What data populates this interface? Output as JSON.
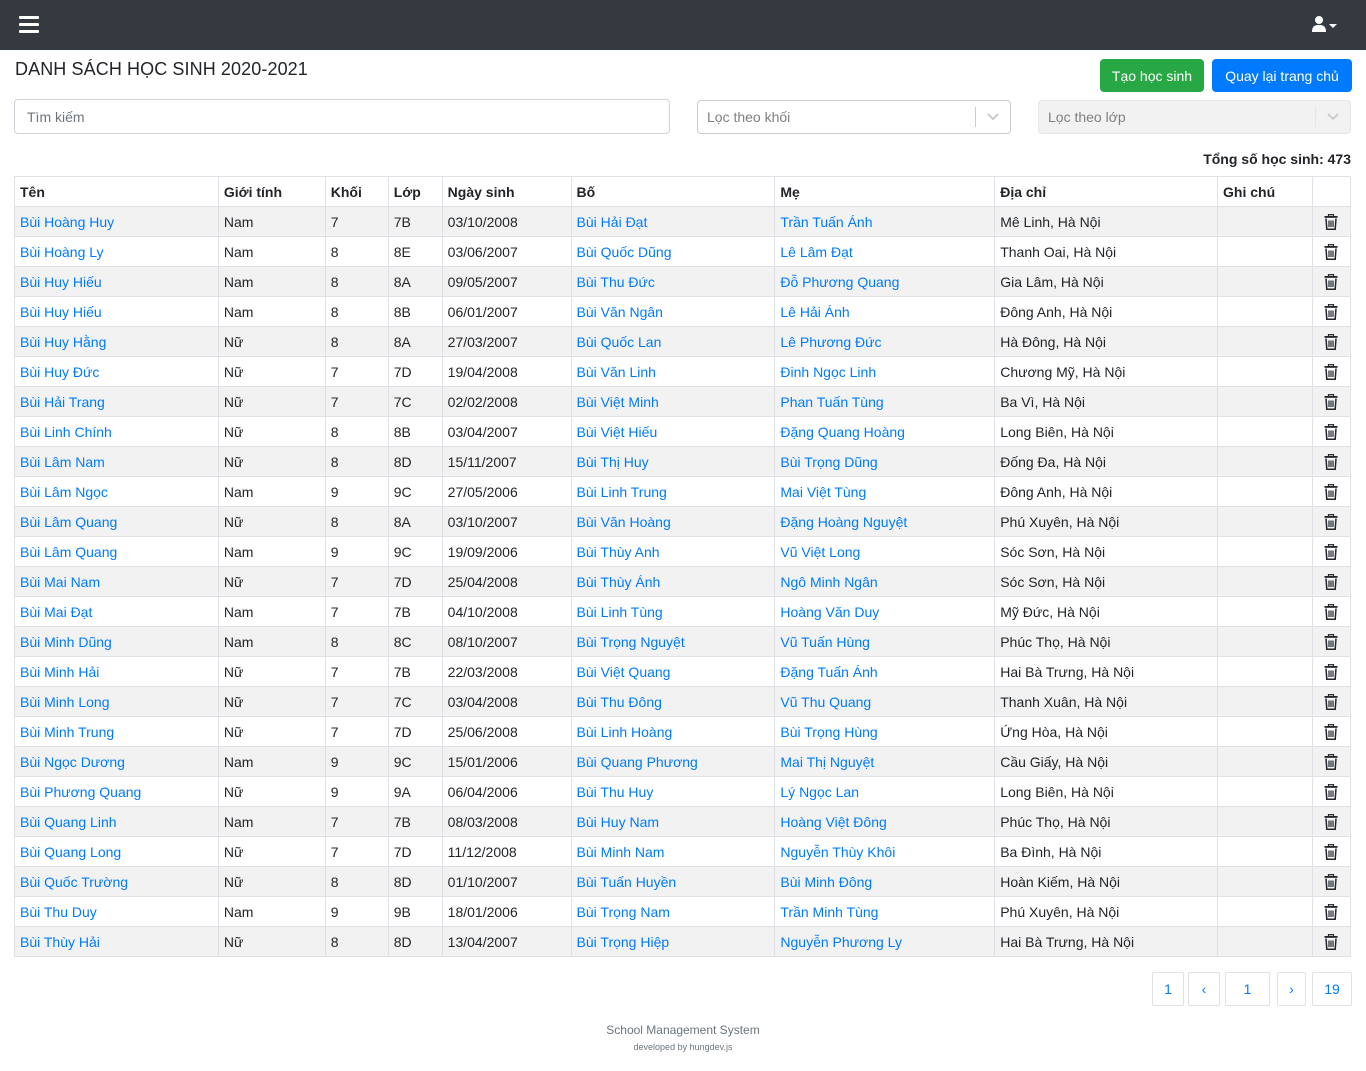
{
  "navbar": {
    "menu_icon": "hamburger-icon",
    "user_icon": "user-icon",
    "caret_icon": "caret-down-icon"
  },
  "page": {
    "title": "DANH SÁCH HỌC SINH 2020-2021"
  },
  "actions": {
    "create_label": "Tạo học sinh",
    "home_label": "Quay lại trang chủ"
  },
  "filters": {
    "search_placeholder": "Tìm kiếm",
    "grade_placeholder": "Lọc theo khối",
    "class_placeholder": "Lọc theo lớp"
  },
  "summary": {
    "total_text": "Tổng số học sinh: 473"
  },
  "table": {
    "headers": [
      "Tên",
      "Giới tính",
      "Khối",
      "Lớp",
      "Ngày sinh",
      "Bố",
      "Mẹ",
      "Địa chỉ",
      "Ghi chú",
      ""
    ],
    "rows": [
      {
        "name": "Bùi Hoàng Huy",
        "gender": "Nam",
        "grade": "7",
        "class": "7B",
        "dob": "03/10/2008",
        "father": "Bùi Hải Đạt",
        "mother": "Trần Tuấn Ánh",
        "address": "Mê Linh, Hà Nội",
        "note": ""
      },
      {
        "name": "Bùi Hoàng Ly",
        "gender": "Nam",
        "grade": "8",
        "class": "8E",
        "dob": "03/06/2007",
        "father": "Bùi Quốc Dũng",
        "mother": "Lê Lâm Đạt",
        "address": "Thanh Oai, Hà Nội",
        "note": ""
      },
      {
        "name": "Bùi Huy Hiếu",
        "gender": "Nam",
        "grade": "8",
        "class": "8A",
        "dob": "09/05/2007",
        "father": "Bùi Thu Đức",
        "mother": "Đỗ Phương Quang",
        "address": "Gia Lâm, Hà Nội",
        "note": ""
      },
      {
        "name": "Bùi Huy Hiếu",
        "gender": "Nam",
        "grade": "8",
        "class": "8B",
        "dob": "06/01/2007",
        "father": "Bùi Văn Ngân",
        "mother": "Lê Hải Ánh",
        "address": "Đông Anh, Hà Nội",
        "note": ""
      },
      {
        "name": "Bùi Huy Hằng",
        "gender": "Nữ",
        "grade": "8",
        "class": "8A",
        "dob": "27/03/2007",
        "father": "Bùi Quốc Lan",
        "mother": "Lê Phương Đức",
        "address": "Hà Đông, Hà Nội",
        "note": ""
      },
      {
        "name": "Bùi Huy Đức",
        "gender": "Nữ",
        "grade": "7",
        "class": "7D",
        "dob": "19/04/2008",
        "father": "Bùi Văn Linh",
        "mother": "Đinh Ngọc Linh",
        "address": "Chương Mỹ, Hà Nội",
        "note": ""
      },
      {
        "name": "Bùi Hải Trang",
        "gender": "Nữ",
        "grade": "7",
        "class": "7C",
        "dob": "02/02/2008",
        "father": "Bùi Việt Minh",
        "mother": "Phan Tuấn Tùng",
        "address": "Ba Vì, Hà Nội",
        "note": ""
      },
      {
        "name": "Bùi Linh Chính",
        "gender": "Nữ",
        "grade": "8",
        "class": "8B",
        "dob": "03/04/2007",
        "father": "Bùi Việt Hiếu",
        "mother": "Đặng Quang Hoàng",
        "address": "Long Biên, Hà Nội",
        "note": ""
      },
      {
        "name": "Bùi Lâm Nam",
        "gender": "Nữ",
        "grade": "8",
        "class": "8D",
        "dob": "15/11/2007",
        "father": "Bùi Thị Huy",
        "mother": "Bùi Trọng Dũng",
        "address": "Đống Đa, Hà Nội",
        "note": ""
      },
      {
        "name": "Bùi Lâm Ngọc",
        "gender": "Nam",
        "grade": "9",
        "class": "9C",
        "dob": "27/05/2006",
        "father": "Bùi Linh Trung",
        "mother": "Mai Việt Tùng",
        "address": "Đông Anh, Hà Nội",
        "note": ""
      },
      {
        "name": "Bùi Lâm Quang",
        "gender": "Nữ",
        "grade": "8",
        "class": "8A",
        "dob": "03/10/2007",
        "father": "Bùi Văn Hoàng",
        "mother": "Đặng Hoàng Nguyệt",
        "address": "Phú Xuyên, Hà Nội",
        "note": ""
      },
      {
        "name": "Bùi Lâm Quang",
        "gender": "Nam",
        "grade": "9",
        "class": "9C",
        "dob": "19/09/2006",
        "father": "Bùi Thùy Anh",
        "mother": "Vũ Việt Long",
        "address": "Sóc Sơn, Hà Nội",
        "note": ""
      },
      {
        "name": "Bùi Mai Nam",
        "gender": "Nữ",
        "grade": "7",
        "class": "7D",
        "dob": "25/04/2008",
        "father": "Bùi Thùy Ánh",
        "mother": "Ngô Minh Ngân",
        "address": "Sóc Sơn, Hà Nội",
        "note": ""
      },
      {
        "name": "Bùi Mai Đạt",
        "gender": "Nam",
        "grade": "7",
        "class": "7B",
        "dob": "04/10/2008",
        "father": "Bùi Linh Tùng",
        "mother": "Hoàng Văn Duy",
        "address": "Mỹ Đức, Hà Nội",
        "note": ""
      },
      {
        "name": "Bùi Minh Dũng",
        "gender": "Nam",
        "grade": "8",
        "class": "8C",
        "dob": "08/10/2007",
        "father": "Bùi Trọng Nguyệt",
        "mother": "Vũ Tuấn Hùng",
        "address": "Phúc Thọ, Hà Nội",
        "note": ""
      },
      {
        "name": "Bùi Minh Hải",
        "gender": "Nữ",
        "grade": "7",
        "class": "7B",
        "dob": "22/03/2008",
        "father": "Bùi Việt Quang",
        "mother": "Đặng Tuấn Ánh",
        "address": "Hai Bà Trưng, Hà Nội",
        "note": ""
      },
      {
        "name": "Bùi Minh Long",
        "gender": "Nữ",
        "grade": "7",
        "class": "7C",
        "dob": "03/04/2008",
        "father": "Bùi Thu Đông",
        "mother": "Vũ Thu Quang",
        "address": "Thanh Xuân, Hà Nội",
        "note": ""
      },
      {
        "name": "Bùi Minh Trung",
        "gender": "Nữ",
        "grade": "7",
        "class": "7D",
        "dob": "25/06/2008",
        "father": "Bùi Linh Hoàng",
        "mother": "Bùi Trọng Hùng",
        "address": "Ứng Hòa, Hà Nội",
        "note": ""
      },
      {
        "name": "Bùi Ngọc Dương",
        "gender": "Nam",
        "grade": "9",
        "class": "9C",
        "dob": "15/01/2006",
        "father": "Bùi Quang Phương",
        "mother": "Mai Thị Nguyệt",
        "address": "Cầu Giấy, Hà Nội",
        "note": ""
      },
      {
        "name": "Bùi Phương Quang",
        "gender": "Nữ",
        "grade": "9",
        "class": "9A",
        "dob": "06/04/2006",
        "father": "Bùi Thu Huy",
        "mother": "Lý Ngọc Lan",
        "address": "Long Biên, Hà Nội",
        "note": ""
      },
      {
        "name": "Bùi Quang Linh",
        "gender": "Nam",
        "grade": "7",
        "class": "7B",
        "dob": "08/03/2008",
        "father": "Bùi Huy Nam",
        "mother": "Hoàng Việt Đông",
        "address": "Phúc Thọ, Hà Nội",
        "note": ""
      },
      {
        "name": "Bùi Quang Long",
        "gender": "Nữ",
        "grade": "7",
        "class": "7D",
        "dob": "11/12/2008",
        "father": "Bùi Minh Nam",
        "mother": "Nguyễn Thùy Khôi",
        "address": "Ba Đình, Hà Nội",
        "note": ""
      },
      {
        "name": "Bùi Quốc Trường",
        "gender": "Nữ",
        "grade": "8",
        "class": "8D",
        "dob": "01/10/2007",
        "father": "Bùi Tuấn Huyền",
        "mother": "Bùi Minh Đông",
        "address": "Hoàn Kiếm, Hà Nội",
        "note": ""
      },
      {
        "name": "Bùi Thu Duy",
        "gender": "Nam",
        "grade": "9",
        "class": "9B",
        "dob": "18/01/2006",
        "father": "Bùi Trọng Nam",
        "mother": "Trần Minh Tùng",
        "address": "Phú Xuyên, Hà Nội",
        "note": ""
      },
      {
        "name": "Bùi Thùy Hải",
        "gender": "Nữ",
        "grade": "8",
        "class": "8D",
        "dob": "13/04/2007",
        "father": "Bùi Trọng Hiệp",
        "mother": "Nguyễn Phương Ly",
        "address": "Hai Bà Trưng, Hà Nội",
        "note": ""
      }
    ],
    "delete_icon": "trash-icon"
  },
  "pagination": {
    "first": "1",
    "prev": "‹",
    "current": "1",
    "next": "›",
    "last": "19"
  },
  "footer": {
    "title": "School Management System",
    "credit": "developed by hungdev.js"
  },
  "colors": {
    "navbar": "#343a40",
    "link": "#007bff",
    "success": "#28a745",
    "primary": "#007bff",
    "stripe": "#f2f2f2"
  }
}
